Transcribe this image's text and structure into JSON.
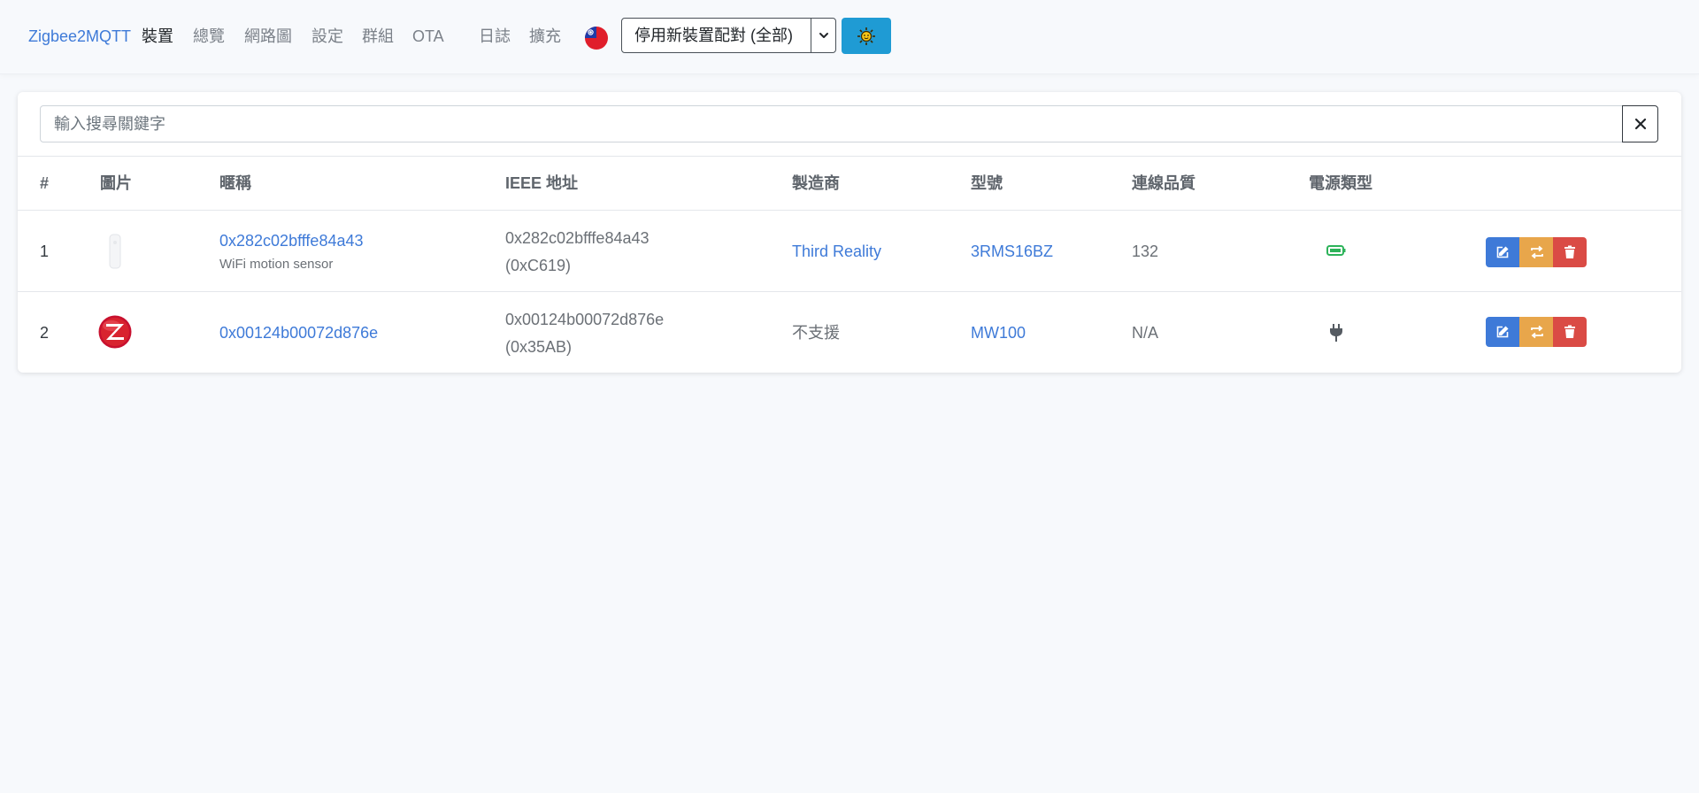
{
  "navbar": {
    "brand": "Zigbee2MQTT",
    "items": [
      "裝置",
      "總覽",
      "網路圖",
      "設定",
      "群組",
      "OTA",
      "日誌",
      "擴充"
    ],
    "active_index": 0,
    "pair_select": {
      "label": "停用新裝置配對 (全部)"
    },
    "theme_toggle_icon": "sun-icon",
    "language_flag_icon": "taiwan-flag-icon"
  },
  "search": {
    "placeholder": "輸入搜尋關鍵字",
    "value": "",
    "clear_icon": "close-icon"
  },
  "table": {
    "columns": [
      "#",
      "圖片",
      "暱稱",
      "IEEE 地址",
      "製造商",
      "型號",
      "連線品質",
      "電源類型"
    ],
    "rows": [
      {
        "index": "1",
        "image_icon": "motion-sensor-image",
        "name": "0x282c02bfffe84a43",
        "description": "WiFi motion sensor",
        "ieee": "0x282c02bfffe84a43",
        "network_address": "(0xC619)",
        "manufacturer": "Third Reality",
        "model": "3RMS16BZ",
        "lqi": "132",
        "power_icon": "battery-icon"
      },
      {
        "index": "2",
        "image_icon": "zigbee-logo-image",
        "name": "0x00124b00072d876e",
        "description": "",
        "ieee": "0x00124b00072d876e",
        "network_address": "(0x35AB)",
        "manufacturer": "不支援",
        "model": "MW100",
        "lqi": "N/A",
        "power_icon": "plug-icon"
      }
    ],
    "actions": [
      "edit-icon",
      "swap-icon",
      "trash-icon"
    ]
  },
  "colors": {
    "accent": "#3e7ad8",
    "edit_button": "#3e7ad8",
    "swap_button": "#e8a64b",
    "delete_button": "#da4b45",
    "theme_button": "#1f9bd4",
    "battery": "#2db35a"
  }
}
